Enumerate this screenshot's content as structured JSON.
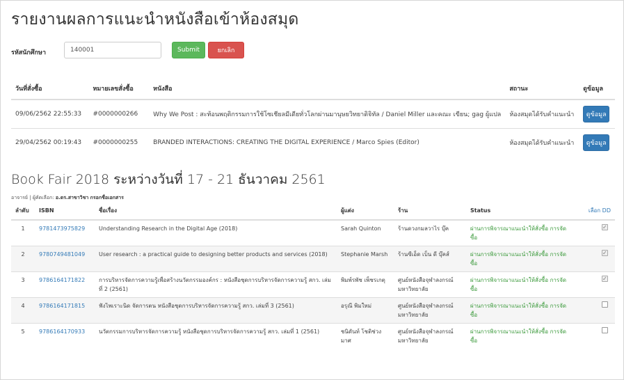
{
  "page_title": "รายงานผลการแนะนำหนังสือเข้าห้องสมุด",
  "filter": {
    "label": "รหัสนักศึกษา",
    "value": "140001",
    "submit_label": "Submit",
    "cancel_label": "ยกเลิก"
  },
  "recommend_table": {
    "headers": [
      "วันที่สั่งซื้อ",
      "หมายเลขสั่งซื้อ",
      "หนังสือ",
      "สถานะ",
      "ดูข้อมูล"
    ],
    "rows": [
      {
        "date": "09/06/2562 22:55:33",
        "order_no": "#0000000266",
        "book": "Why We Post : สะท้อนพฤติกรรมการใช้โซเชียลมีเดียทั่วโลกผ่านมานุษยวิทยาดิจิทัล / Daniel Miller และคณะ เขียน; gag ผู้แปล",
        "status": "ห้องสมุดได้รับคำแนะนำ",
        "action": "ดูข้อมูล"
      },
      {
        "date": "29/04/2562 00:19:43",
        "order_no": "#0000000255",
        "book": "BRANDED INTERACTIONS: CREATING THE DIGITAL EXPERIENCE / Marco Spies (Editor)",
        "status": "ห้องสมุดได้รับคำแนะนำ",
        "action": "ดูข้อมูล"
      }
    ]
  },
  "bookfair": {
    "title": "Book Fair 2018 ระหว่างวันที่ 17 - 21 ธันวาคม 2561",
    "subtitle_prefix": "อาจารย์ | ผู้คัดเลือก:",
    "subtitle_name": "อ.ดร.สาขาวิชา กรอกชื่อเอกสาร",
    "headers": [
      "ลำดับ",
      "ISBN",
      "ชื่อเรื่อง",
      "ผู้แต่ง",
      "ร้าน",
      "Status",
      "เลือก DD"
    ],
    "rows": [
      {
        "no": "1",
        "isbn": "9781473975829",
        "title": "Understanding Research in the Digital Age (2018)",
        "author": "Sarah Quinton",
        "shop": "ร้านดวงกมลวาไร บุ๊ค",
        "status": "ผ่านการพิจารณาแนะนำให้สั่งซื้อ การจัดซื้อ",
        "checked": true
      },
      {
        "no": "2",
        "isbn": "9780749481049",
        "title": "User research : a practical guide to designing better products and services (2018)",
        "author": "Stephanie Marsh",
        "shop": "ร้านซีเอ็ด เบ็น ดี บุ๊คส์",
        "status": "ผ่านการพิจารณาแนะนำให้สั่งซื้อ การจัดซื้อ",
        "checked": true
      },
      {
        "no": "3",
        "isbn": "9786164171822",
        "title": "การบริหารจัดการความรู้เพื่อสร้างนวัตกรรมองค์กร : หนังสือชุดการบริหารจัดการความรู้ สกว. เล่มที่ 2 (2561)",
        "author": "พิมพ์รพัช เพ็ชรเกตุ",
        "shop": "ศูนย์หนังสือจุฬาลงกรณ์มหาวิทยาลัย",
        "status": "ผ่านการพิจารณาแนะนำให้สั่งซื้อ การจัดซื้อ",
        "checked": true
      },
      {
        "no": "4",
        "isbn": "9786164171815",
        "title": "ฟังไพเราะนิด จัดการตน หนังสือชุดการบริหารจัดการความรู้ สกว. เล่มที่ 3 (2561)",
        "author": "อรุณี พิมใหม่",
        "shop": "ศูนย์หนังสือจุฬาลงกรณ์มหาวิทยาลัย",
        "status": "ผ่านการพิจารณาแนะนำให้สั่งซื้อ การจัดซื้อ",
        "checked": false
      },
      {
        "no": "5",
        "isbn": "9786164170933",
        "title": "นวัตกรรมการบริหารจัดการความรู้ หนังสือชุดการบริหารจัดการความรู้ สกว. เล่มที่ 1 (2561)",
        "author": "ชนิดันท์ โชติช่วง มาศ",
        "shop": "ศูนย์หนังสือจุฬาลงกรณ์มหาวิทยาลัย",
        "status": "ผ่านการพิจารณาแนะนำให้สั่งซื้อ การจัดซื้อ",
        "checked": false
      }
    ]
  },
  "colors": {
    "submit": "#5cb85c",
    "cancel": "#d9534f",
    "action": "#337ab7",
    "link": "#337ab7",
    "status": "#3c9a3c"
  }
}
